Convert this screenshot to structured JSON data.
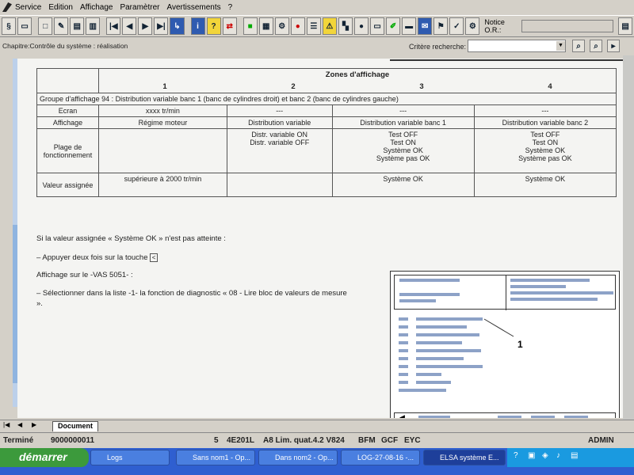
{
  "menu": {
    "items": [
      "Service",
      "Edition",
      "Affichage",
      "Paramètrer",
      "Avertissements",
      "?"
    ]
  },
  "toolbar": {
    "notice_label": "Notice O.R.:",
    "buttons": [
      "close-icon",
      "save-icon",
      "new-icon",
      "edit-icon",
      "print-icon",
      "copy-icon",
      "first-icon",
      "prev-icon",
      "next-icon",
      "last-icon",
      "link-icon",
      "info-icon",
      "help-icon",
      "switch-icon",
      "car-icon",
      "book-icon",
      "tool-icon",
      "stop-icon",
      "list-icon",
      "warning-icon",
      "chart-icon",
      "circle-icon",
      "doc-icon",
      "pen-icon",
      "bus-icon",
      "envelope-icon",
      "flag-icon",
      "check-icon",
      "gear-icon"
    ]
  },
  "chapter": {
    "text": "Chapitre:Contrôle du système : réalisation",
    "criteria_label": "Critère recherche:"
  },
  "table": {
    "header": "Zones d'affichage",
    "zones": [
      "1",
      "2",
      "3",
      "4"
    ],
    "group": "Groupe d'affichage 94 : Distribution variable banc 1 (banc de cylindres droit) et banc 2 (banc de cylindres gauche)",
    "rows": [
      {
        "label": "Ecran",
        "cells": [
          "xxxx tr/min",
          "---",
          "---",
          "---"
        ]
      },
      {
        "label": "Affichage",
        "cells": [
          "Régime moteur",
          "Distribution variable",
          "Distribution variable banc 1",
          "Distribution variable banc 2"
        ]
      },
      {
        "label": "Plage de fonctionnement",
        "cells": [
          "",
          "Distr. variable ON\nDistr. variable OFF",
          "Test OFF\nTest ON\nSystème OK\nSystème pas OK",
          "Test OFF\nTest ON\nSystème OK\nSystème pas OK"
        ]
      },
      {
        "label": "Valeur assignée",
        "cells": [
          "supérieure à 2000 tr/min",
          "",
          "Système OK",
          "Système OK"
        ]
      }
    ]
  },
  "body": {
    "line1": "Si la valeur assignée « Système OK » n'est pas atteinte :",
    "line2": "–   Appuyer deux fois sur la touche",
    "key": "<",
    "line3": "Affichage sur le -VAS 5051- :",
    "line4": "–   Sélectionner dans la liste -1- la fonction de diagnostic « 08 - Lire bloc de valeurs de mesure »."
  },
  "figure": {
    "callout": "1"
  },
  "tabs": {
    "document": "Document"
  },
  "status": {
    "left": "Terminé",
    "vin": "9000000011",
    "num": "5",
    "code": "4E201L",
    "model": "A8 Lim. quat.4.2 V824",
    "c1": "BFM",
    "c2": "GCF",
    "c3": "EYC",
    "user": "ADMIN"
  },
  "taskbar": {
    "start": "démarrer",
    "tasks": [
      "Logs",
      "Sans nom1 - Op...",
      "Dans nom2 - Op...",
      "LOG-27-08-16 -...",
      "ELSA système E..."
    ]
  }
}
